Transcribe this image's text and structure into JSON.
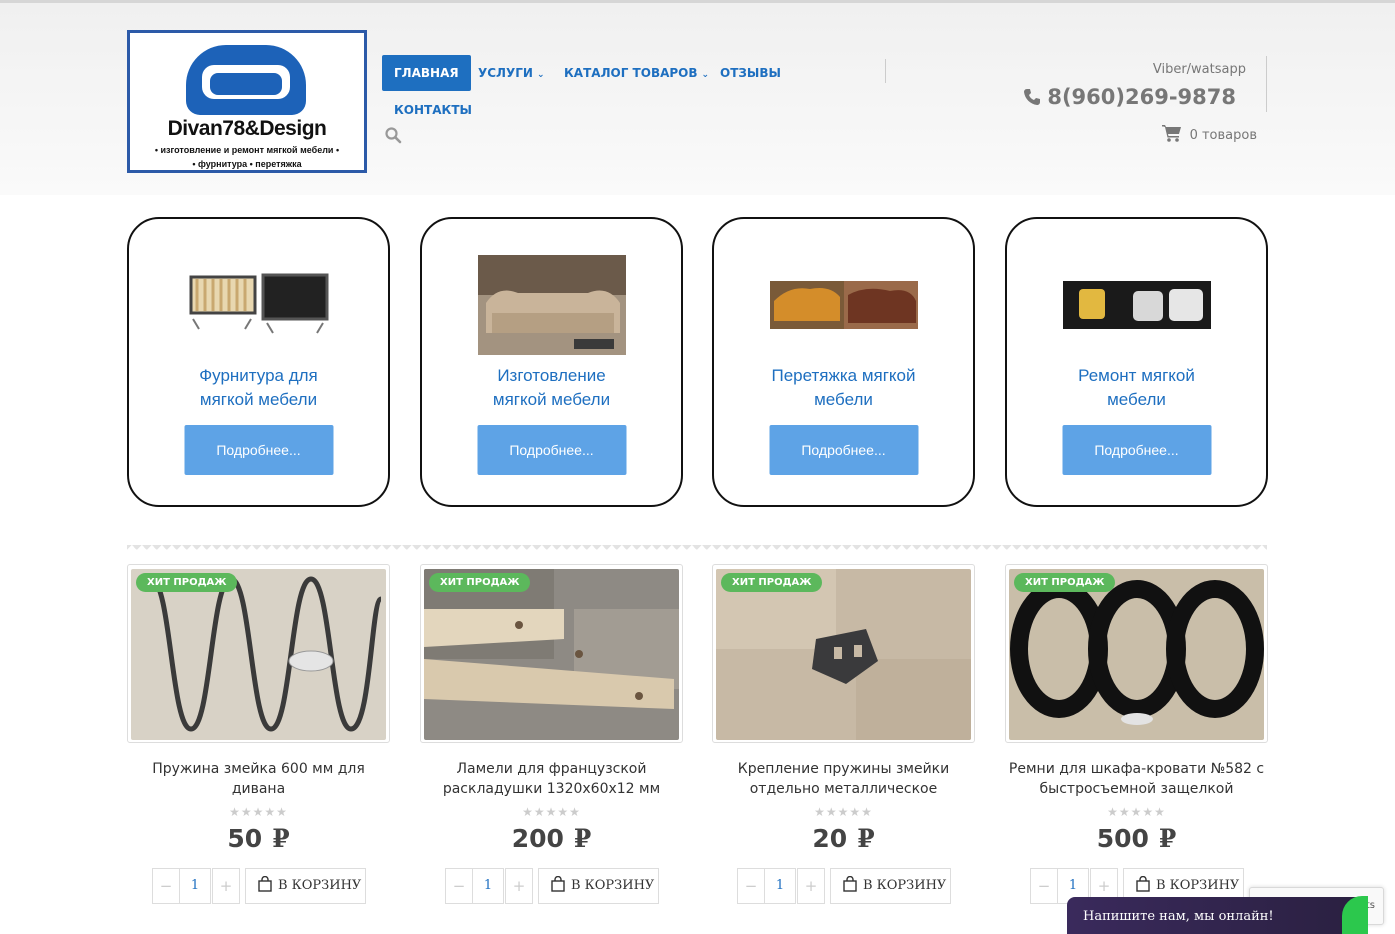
{
  "logo": {
    "name": "Divan78&Design",
    "line1": "• изготовление и ремонт мягкой мебели •",
    "line2": "• фурнитура • перетяжка"
  },
  "nav": {
    "items": [
      {
        "label": "ГЛАВНАЯ",
        "active": true
      },
      {
        "label": "УСЛУГИ",
        "dropdown": true
      },
      {
        "label": "КАТАЛОГ ТОВАРОВ",
        "dropdown": true
      },
      {
        "label": "ОТЗЫВЫ"
      },
      {
        "label": "КОНТАКТЫ"
      }
    ]
  },
  "contact": {
    "viber": "Viber/watsapp",
    "phone": "8(960)269-9878",
    "cart": "0 товаров"
  },
  "categories": [
    {
      "title_l1": "Фурнитура для",
      "title_l2": "мягкой мебели",
      "button": "Подробнее..."
    },
    {
      "title_l1": "Изготовление",
      "title_l2": "мягкой мебели",
      "button": "Подробнее..."
    },
    {
      "title_l1": "Перетяжка мягкой",
      "title_l2": "мебели",
      "button": "Подробнее..."
    },
    {
      "title_l1": "Ремонт мягкой",
      "title_l2": "мебели",
      "button": "Подробнее..."
    }
  ],
  "products": [
    {
      "badge": "ХИТ ПРОДАЖ",
      "title": "Пружина змейка 600 мм для дивана",
      "stars": "★★★★★",
      "price": "50",
      "currency": "₽",
      "qty": "1",
      "add": "В КОРЗИНУ"
    },
    {
      "badge": "ХИТ ПРОДАЖ",
      "title": "Ламели для французской раскладушки 1320x60x12 мм",
      "stars": "★★★★★",
      "price": "200",
      "currency": "₽",
      "qty": "1",
      "add": "В КОРЗИНУ"
    },
    {
      "badge": "ХИТ ПРОДАЖ",
      "title": "Крепление пружины змейки отдельно металлическое",
      "stars": "★★★★★",
      "price": "20",
      "currency": "₽",
      "qty": "1",
      "add": "В КОРЗИНУ"
    },
    {
      "badge": "ХИТ ПРОДАЖ",
      "title": "Ремни для шкафа-кровати №582 с быстросъемной защелкой",
      "stars": "★★★★★",
      "price": "500",
      "currency": "₽",
      "qty": "1",
      "add": "В КОРЗИНУ"
    }
  ],
  "qty_minus": "−",
  "qty_plus": "+",
  "recaptcha": "nents",
  "chat": "Напишите нам, мы онлайн!"
}
